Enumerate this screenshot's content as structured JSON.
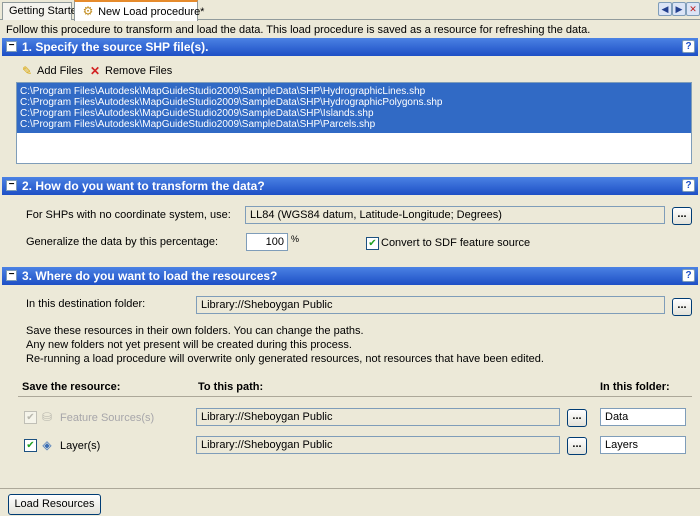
{
  "tabs": [
    {
      "label": "Getting Started"
    },
    {
      "label": "New Load procedure*"
    }
  ],
  "intro": "Follow this procedure to transform and load the data. This load procedure is saved as a resource for refreshing the data.",
  "section1": {
    "title": "1. Specify the source SHP file(s).",
    "add_label": "Add Files",
    "remove_label": "Remove Files",
    "files": [
      "C:\\Program Files\\Autodesk\\MapGuideStudio2009\\SampleData\\SHP\\HydrographicLines.shp",
      "C:\\Program Files\\Autodesk\\MapGuideStudio2009\\SampleData\\SHP\\HydrographicPolygons.shp",
      "C:\\Program Files\\Autodesk\\MapGuideStudio2009\\SampleData\\SHP\\Islands.shp",
      "C:\\Program Files\\Autodesk\\MapGuideStudio2009\\SampleData\\SHP\\Parcels.shp"
    ]
  },
  "section2": {
    "title": "2. How do you want to transform the data?",
    "coord_label": "For SHPs with no coordinate system, use:",
    "coord_value": "LL84 (WGS84 datum, Latitude-Longitude; Degrees)",
    "generalize_label": "Generalize the data by this percentage:",
    "generalize_value": "100",
    "percent_sign": "%",
    "convert_label": "Convert to SDF feature source"
  },
  "section3": {
    "title": "3. Where do you want to load the resources?",
    "dest_label": "In this destination folder:",
    "dest_value": "Library://Sheboygan Public",
    "note1": "Save these resources in their own folders. You can change the paths.",
    "note2": "Any new folders not yet present will be created during this process.",
    "note3": "Re-running a load procedure will overwrite only generated resources, not resources that have been edited.",
    "col_save": "Save the resource:",
    "col_path": "To this path:",
    "col_folder": "In this folder:",
    "rows": [
      {
        "label": "Feature Sources(s)",
        "path": "Library://Sheboygan Public",
        "folder": "Data"
      },
      {
        "label": "Layer(s)",
        "path": "Library://Sheboygan Public",
        "folder": "Layers"
      }
    ]
  },
  "buttons": {
    "browse": "...",
    "load": "Load Resources"
  },
  "colors": {
    "header_blue": "#1d4fc5",
    "selection": "#316ac5",
    "tab_accent": "#e68b2c"
  }
}
